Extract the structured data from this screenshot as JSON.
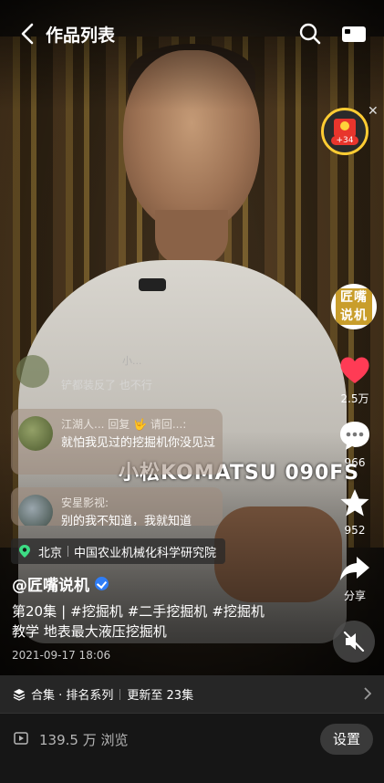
{
  "topbar": {
    "title": "作品列表"
  },
  "reward": {
    "amount": "+34"
  },
  "author_avatar": {
    "logo_text": "匠嘴说机"
  },
  "actions": {
    "likes": "2.5万",
    "comments": "966",
    "favorites": "952",
    "share": "分享"
  },
  "comments": {
    "faded_text": "铲都装反了  也不行",
    "faded_partial": "小...",
    "bubble1": {
      "name": "江湖人... 回复 🤟 请回...:",
      "text": "就怕我见过的挖掘机你没见过"
    },
    "bubble2": {
      "name": "安星影视:",
      "text": "别的我不知道，我就知道"
    }
  },
  "video_subtitle": "小松KOMATSU 090FS",
  "location": {
    "city": "北京",
    "place": "中国农业机械化科学研究院"
  },
  "author": {
    "handle": "@匠嘴说机"
  },
  "description": {
    "episode": "第20集",
    "divider": "|",
    "tags": [
      "#挖掘机",
      "#二手挖掘机",
      "#挖掘机"
    ],
    "rest": "教学 地表最大液压挖掘机"
  },
  "date": "2021-09-17 18:06",
  "collection": {
    "label": "合集 · 排名系列",
    "update": "更新至 23集"
  },
  "bottom": {
    "views": "139.5 万 浏览",
    "settings_label": "设置"
  },
  "colors": {
    "like_red": "#ff3b55",
    "verify_blue": "#2f7df6",
    "reward_gold": "#ffcc33",
    "location_green": "#3ddc84"
  }
}
